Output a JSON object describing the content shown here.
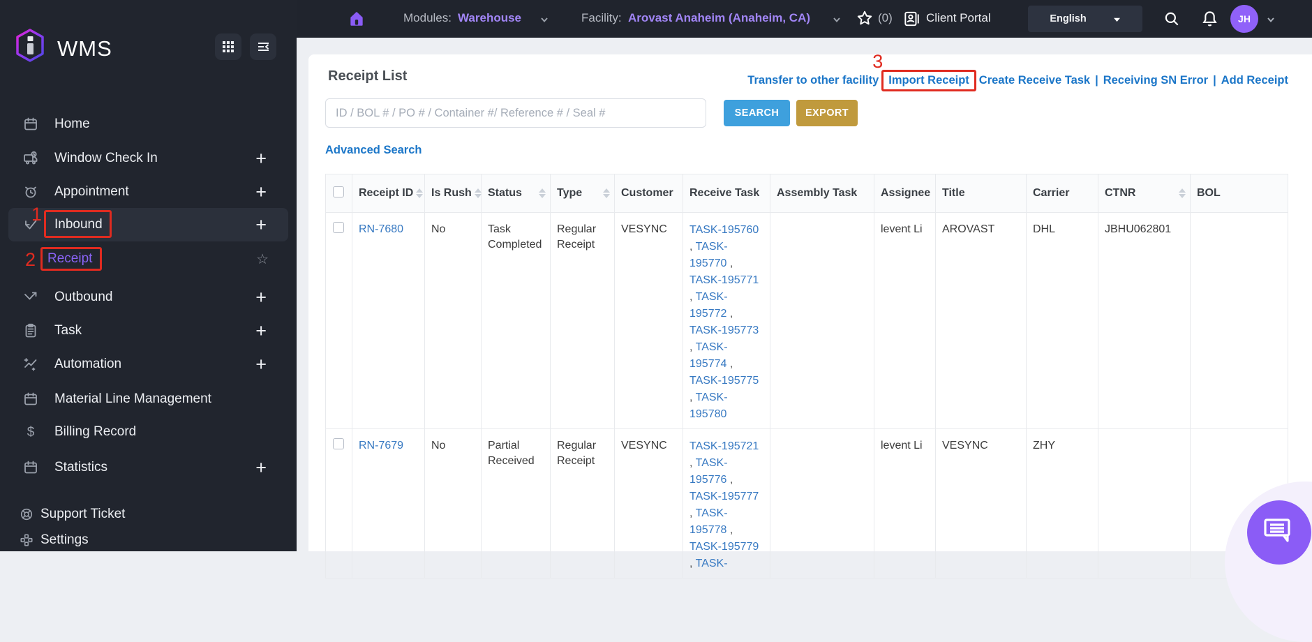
{
  "topbar": {
    "modules_label": "Modules:",
    "modules_value": "Warehouse",
    "facility_label": "Facility:",
    "facility_value": "Arovast Anaheim  (Anaheim, CA)",
    "favorites_count": "(0)",
    "client_portal_label": "Client Portal",
    "language": "English",
    "avatar_initials": "JH"
  },
  "sidebar": {
    "brand": "WMS",
    "items": [
      {
        "label": "Home",
        "icon": "calendar-icon",
        "plus": false
      },
      {
        "label": "Window Check In",
        "icon": "truck-clock-icon",
        "plus": true
      },
      {
        "label": "Appointment",
        "icon": "alarm-clock-icon",
        "plus": true
      },
      {
        "label": "Inbound",
        "icon": "inbound-check-icon",
        "plus": true,
        "active": true
      },
      {
        "label": "Receipt",
        "sub": true,
        "star": true
      },
      {
        "label": "Outbound",
        "icon": "outbound-arrow-icon",
        "plus": true
      },
      {
        "label": "Task",
        "icon": "clipboard-icon",
        "plus": true
      },
      {
        "label": "Automation",
        "icon": "automation-sparkline-icon",
        "plus": true
      },
      {
        "label": "Material Line Management",
        "icon": "calendar-icon",
        "plus": false
      },
      {
        "label": "Billing Record",
        "icon": "dollar-icon",
        "plus": false
      },
      {
        "label": "Statistics",
        "icon": "calendar-icon",
        "plus": true
      }
    ],
    "footer_items": [
      {
        "label": "Support Ticket",
        "icon": "lifebuoy-icon"
      },
      {
        "label": "Settings",
        "icon": "nodes-icon"
      }
    ]
  },
  "annotations": {
    "step1": "1",
    "step2": "2",
    "step3": "3"
  },
  "main": {
    "title": "Receipt List",
    "actions": [
      "Transfer to other facility",
      "Import Receipt",
      "Create Receive Task",
      "Receiving SN Error",
      "Add Receipt"
    ],
    "action_separator": "|",
    "search_placeholder": "ID / BOL # / PO # / Container #/ Reference # / Seal #",
    "search_button": "SEARCH",
    "export_button": "EXPORT",
    "advanced_search": "Advanced Search",
    "table": {
      "columns": [
        {
          "label": "Receipt ID",
          "sortable": true
        },
        {
          "label": "Is Rush",
          "sortable": true
        },
        {
          "label": "Status",
          "sortable": true
        },
        {
          "label": "Type",
          "sortable": true
        },
        {
          "label": "Customer",
          "sortable": false
        },
        {
          "label": "Receive Task",
          "sortable": false
        },
        {
          "label": "Assembly Task",
          "sortable": false
        },
        {
          "label": "Assignee",
          "sortable": false
        },
        {
          "label": "Title",
          "sortable": false
        },
        {
          "label": "Carrier",
          "sortable": false
        },
        {
          "label": "CTNR",
          "sortable": true
        },
        {
          "label": "BOL",
          "sortable": false
        }
      ],
      "rows": [
        {
          "receipt_id": "RN-7680",
          "is_rush": "No",
          "status": "Task Completed",
          "type": "Regular Receipt",
          "customer": "VESYNC",
          "receive_tasks": [
            "TASK-195760",
            "TASK-195770",
            "TASK-195771",
            "TASK-195772",
            "TASK-195773",
            "TASK-195774",
            "TASK-195775",
            "TASK-195780"
          ],
          "receive_tasks_partial": "",
          "assembly_task": "",
          "assignee": "levent Li",
          "title": "AROVAST",
          "carrier": "DHL",
          "ctnr": "JBHU062801",
          "bol": ""
        },
        {
          "receipt_id": "RN-7679",
          "is_rush": "No",
          "status": "Partial Received",
          "type": "Regular Receipt",
          "customer": "VESYNC",
          "receive_tasks": [
            "TASK-195721",
            "TASK-195776",
            "TASK-195777",
            "TASK-195778",
            "TASK-195779"
          ],
          "receive_tasks_partial": "TASK-",
          "assembly_task": "",
          "assignee": "levent Li",
          "title": "VESYNC",
          "carrier": "ZHY",
          "ctnr": "",
          "bol": ""
        }
      ]
    }
  },
  "colors": {
    "accent_purple": "#8b5cf6",
    "action_link_blue": "#1b76c8",
    "table_link_blue": "#3779c2",
    "search_button": "#3ea0dd",
    "export_button": "#c09a3d",
    "annotation_red": "#e02b20",
    "sidebar_bg": "#21252e",
    "active_item_bg": "#2b303b"
  }
}
